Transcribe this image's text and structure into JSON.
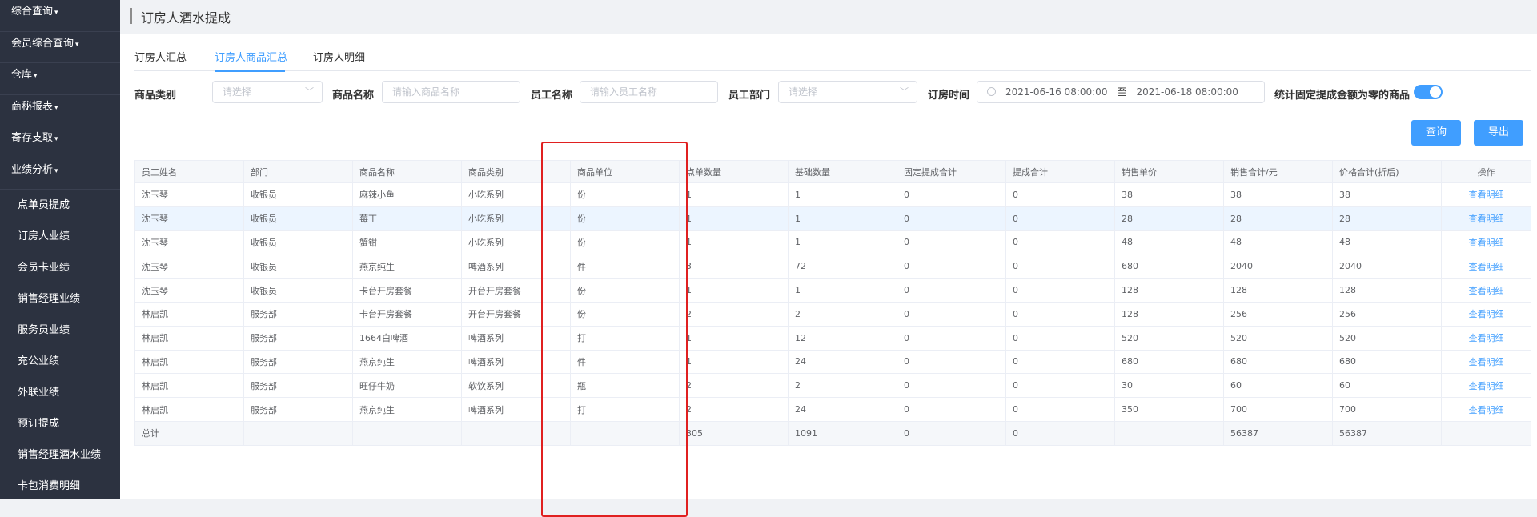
{
  "sidebar": {
    "groups": [
      {
        "label": "综合查询"
      },
      {
        "label": "会员综合查询"
      },
      {
        "label": "仓库"
      },
      {
        "label": "商秘报表"
      },
      {
        "label": "寄存支取"
      },
      {
        "label": "业绩分析"
      }
    ],
    "items": [
      {
        "label": "点单员提成"
      },
      {
        "label": "订房人业绩"
      },
      {
        "label": "会员卡业绩"
      },
      {
        "label": "销售经理业绩"
      },
      {
        "label": "服务员业绩"
      },
      {
        "label": "充公业绩"
      },
      {
        "label": "外联业绩"
      },
      {
        "label": "预订提成"
      },
      {
        "label": "销售经理酒水业绩"
      },
      {
        "label": "卡包消费明细"
      }
    ]
  },
  "page": {
    "title": "订房人酒水提成"
  },
  "tabs": [
    {
      "label": "订房人汇总"
    },
    {
      "label": "订房人商品汇总"
    },
    {
      "label": "订房人明细"
    }
  ],
  "filters": {
    "category_label": "商品类别",
    "category_placeholder": "请选择",
    "name_label": "商品名称",
    "name_placeholder": "请输入商品名称",
    "staff_label": "员工名称",
    "staff_placeholder": "请输入员工名称",
    "dept_label": "员工部门",
    "dept_placeholder": "请选择",
    "time_label": "订房时间",
    "time_start": "2021-06-16 08:00:00",
    "time_sep": "至",
    "time_end": "2021-06-18 08:00:00",
    "zero_label": "统计固定提成金额为零的商品",
    "zero_enabled": true
  },
  "buttons": {
    "query": "查询",
    "export": "导出"
  },
  "table": {
    "columns": [
      "员工姓名",
      "部门",
      "商品名称",
      "商品类别",
      "商品单位",
      "点单数量",
      "基础数量",
      "固定提成合计",
      "提成合计",
      "销售单价",
      "销售合计/元",
      "价格合计(折后)",
      "操作"
    ],
    "rows": [
      {
        "name": "沈玉琴",
        "dept": "收银员",
        "product": "麻辣小鱼",
        "category": "小吃系列",
        "unit": "份",
        "order_qty": "1",
        "base_qty": "1",
        "fixed_comm": "0",
        "comm": "0",
        "price": "38",
        "sales": "38",
        "net": "38",
        "action": "查看明细"
      },
      {
        "name": "沈玉琴",
        "dept": "收银员",
        "product": "莓丁",
        "category": "小吃系列",
        "unit": "份",
        "order_qty": "1",
        "base_qty": "1",
        "fixed_comm": "0",
        "comm": "0",
        "price": "28",
        "sales": "28",
        "net": "28",
        "action": "查看明细"
      },
      {
        "name": "沈玉琴",
        "dept": "收银员",
        "product": "蟹钳",
        "category": "小吃系列",
        "unit": "份",
        "order_qty": "1",
        "base_qty": "1",
        "fixed_comm": "0",
        "comm": "0",
        "price": "48",
        "sales": "48",
        "net": "48",
        "action": "查看明细"
      },
      {
        "name": "沈玉琴",
        "dept": "收银员",
        "product": "燕京纯生",
        "category": "啤酒系列",
        "unit": "件",
        "order_qty": "3",
        "base_qty": "72",
        "fixed_comm": "0",
        "comm": "0",
        "price": "680",
        "sales": "2040",
        "net": "2040",
        "action": "查看明细"
      },
      {
        "name": "沈玉琴",
        "dept": "收银员",
        "product": "卡台开房套餐",
        "category": "开台开房套餐",
        "unit": "份",
        "order_qty": "1",
        "base_qty": "1",
        "fixed_comm": "0",
        "comm": "0",
        "price": "128",
        "sales": "128",
        "net": "128",
        "action": "查看明细"
      },
      {
        "name": "林启凯",
        "dept": "服务部",
        "product": "卡台开房套餐",
        "category": "开台开房套餐",
        "unit": "份",
        "order_qty": "2",
        "base_qty": "2",
        "fixed_comm": "0",
        "comm": "0",
        "price": "128",
        "sales": "256",
        "net": "256",
        "action": "查看明细"
      },
      {
        "name": "林启凯",
        "dept": "服务部",
        "product": "1664白啤酒",
        "category": "啤酒系列",
        "unit": "打",
        "order_qty": "1",
        "base_qty": "12",
        "fixed_comm": "0",
        "comm": "0",
        "price": "520",
        "sales": "520",
        "net": "520",
        "action": "查看明细"
      },
      {
        "name": "林启凯",
        "dept": "服务部",
        "product": "燕京纯生",
        "category": "啤酒系列",
        "unit": "件",
        "order_qty": "1",
        "base_qty": "24",
        "fixed_comm": "0",
        "comm": "0",
        "price": "680",
        "sales": "680",
        "net": "680",
        "action": "查看明细"
      },
      {
        "name": "林启凯",
        "dept": "服务部",
        "product": "旺仔牛奶",
        "category": "软饮系列",
        "unit": "瓶",
        "order_qty": "2",
        "base_qty": "2",
        "fixed_comm": "0",
        "comm": "0",
        "price": "30",
        "sales": "60",
        "net": "60",
        "action": "查看明细"
      },
      {
        "name": "林启凯",
        "dept": "服务部",
        "product": "燕京纯生",
        "category": "啤酒系列",
        "unit": "打",
        "order_qty": "2",
        "base_qty": "24",
        "fixed_comm": "0",
        "comm": "0",
        "price": "350",
        "sales": "700",
        "net": "700",
        "action": "查看明细"
      }
    ],
    "total": {
      "label": "总计",
      "order_qty": "305",
      "base_qty": "1091",
      "fixed_comm": "0",
      "comm": "0",
      "sales": "56387",
      "net": "56387"
    }
  },
  "colors": {
    "accent": "#409eff",
    "sidebar_bg": "#2c3240",
    "highlight_box": "#e02020",
    "row_hover": "#ecf5ff"
  },
  "icons": {
    "caret": "caret-down-icon",
    "select": "chevron-down-icon",
    "date": "clock-icon"
  }
}
